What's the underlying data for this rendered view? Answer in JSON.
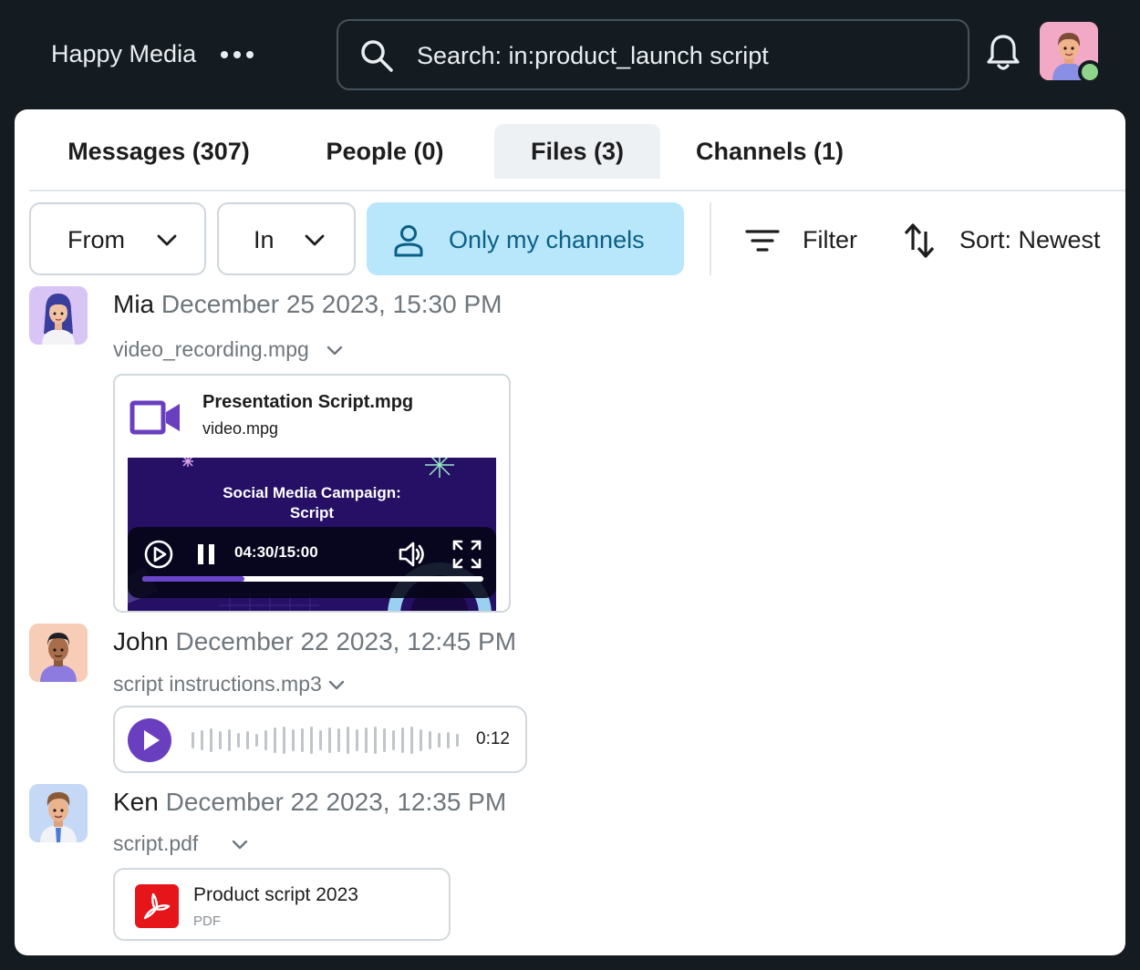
{
  "topbar": {
    "workspace_name": "Happy Media",
    "search_value": "Search: in:product_launch script"
  },
  "tabs": [
    {
      "label": "Messages (307)",
      "active": false
    },
    {
      "label": "People (0)",
      "active": false
    },
    {
      "label": "Files (3)",
      "active": true
    },
    {
      "label": "Channels (1)",
      "active": false
    }
  ],
  "filters": {
    "from_label": "From",
    "in_label": "In",
    "only_my_channels_label": "Only my channels",
    "filter_label": "Filter",
    "sort_label": "Sort: Newest"
  },
  "results": [
    {
      "author": "Mia",
      "timestamp": "December 25 2023, 15:30 PM",
      "file_name": "video_recording.mpg",
      "attachment": {
        "title": "Presentation Script.mpg",
        "subtitle": "video.mpg",
        "video_title": "Social Media Campaign:\nScript",
        "time": "04:30/15:00",
        "progress": 0.3
      }
    },
    {
      "author": "John",
      "timestamp": "December 22 2023, 12:45 PM",
      "file_name": "script instructions.mp3",
      "attachment": {
        "duration": "0:12"
      }
    },
    {
      "author": "Ken",
      "timestamp": "December 22 2023, 12:35 PM",
      "file_name": "script.pdf",
      "attachment": {
        "title": "Product script 2023",
        "type": "PDF"
      }
    }
  ],
  "colors": {
    "background": "#151c21",
    "accent_purple": "#6a3fbf",
    "chip_active": "#b8e6fa",
    "status_online": "#8fd48a",
    "pdf_red": "#e5151a"
  }
}
